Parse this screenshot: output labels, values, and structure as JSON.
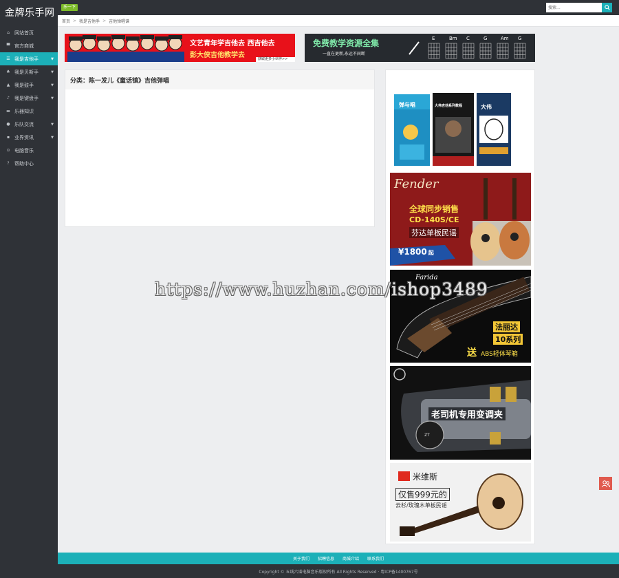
{
  "brand": "金牌乐手网",
  "sidebar": {
    "items": [
      {
        "label": "网站首页",
        "icon": "home-icon",
        "glyph": "⌂",
        "caret": false,
        "active": false
      },
      {
        "label": "官方商城",
        "icon": "cart-icon",
        "glyph": "▀",
        "caret": false,
        "active": false
      },
      {
        "label": "我是吉他手",
        "icon": "list-icon",
        "glyph": "☰",
        "caret": true,
        "active": true
      },
      {
        "label": "我是贝斯手",
        "icon": "guitar-icon",
        "glyph": "♣",
        "caret": true,
        "active": false
      },
      {
        "label": "我是鼓手",
        "icon": "drum-icon",
        "glyph": "▲",
        "caret": true,
        "active": false
      },
      {
        "label": "我是键盘手",
        "icon": "keyboard-icon",
        "glyph": "♪",
        "caret": true,
        "active": false
      },
      {
        "label": "乐器知识",
        "icon": "folder-icon",
        "glyph": "▬",
        "caret": false,
        "active": false
      },
      {
        "label": "乐队交流",
        "icon": "user-icon",
        "glyph": "●",
        "caret": true,
        "active": false
      },
      {
        "label": "业界资讯",
        "icon": "news-icon",
        "glyph": "▪",
        "caret": true,
        "active": false
      },
      {
        "label": "电脑音乐",
        "icon": "settings-icon",
        "glyph": "⊙",
        "caret": false,
        "active": false
      },
      {
        "label": "帮助中心",
        "icon": "help-icon",
        "glyph": "?",
        "caret": false,
        "active": false
      }
    ]
  },
  "topbar": {
    "badge": "乐一下",
    "search_placeholder": "搜索..."
  },
  "breadcrumb": [
    "首页",
    "我是吉他手",
    "吉他弹唱谱"
  ],
  "banners": {
    "left_text_1": "文艺青年学吉他去 西吉他去",
    "left_text_2": "彭大侠吉他教学去",
    "left_link": "获取更多小伙伴>>",
    "right_title": "免费教学资源全集",
    "right_sub": "一直在更新,永远不间断",
    "chords": [
      "E",
      "Bm",
      "C",
      "G",
      "Am",
      "G"
    ]
  },
  "panel": {
    "title": "分类：陈一发儿《童话镇》吉他弹唱"
  },
  "ads": {
    "books": {
      "title_a": "弹与唱",
      "title_b": "大伟吉他系列教程",
      "title_c": "大伟"
    },
    "fender": {
      "brand": "Fender",
      "line1": "全球同步销售",
      "line2": "CD-140S/CE",
      "line3": "芬达单板民谣",
      "price": "¥1800",
      "price_suffix": "起"
    },
    "farida": {
      "brand": "Farida",
      "line1": "法丽达",
      "line2": "10系列",
      "gift": "送",
      "gift_text": "ABS轻体琴箱"
    },
    "capo": {
      "text": "老司机专用变调夹",
      "model": "ZT"
    },
    "mavis": {
      "brand": "米维斯",
      "price": "仅售999元的",
      "desc": "云杉/玫瑰木单板民谣"
    }
  },
  "watermark": "https://www.huzhan.com/ishop3489",
  "footer": {
    "links": [
      "关于我们",
      "招聘信息",
      "商城介绍",
      "联系我们"
    ],
    "copyright": "Copyright © 五线六谱电脑音乐版权所有 All Rights Reserved · 粤ICP备1400767号"
  },
  "colors": {
    "accent": "#1cb0b8",
    "sidebar": "#2f3237",
    "float": "#e05a4e"
  }
}
